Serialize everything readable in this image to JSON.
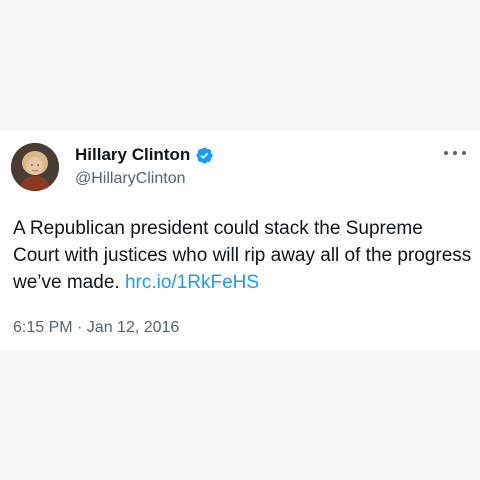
{
  "tweet": {
    "author": {
      "display_name": "Hillary Clinton",
      "handle": "@HillaryClinton",
      "verified": true,
      "avatar_icon": "profile-photo"
    },
    "text": "A Republican president could stack the Supreme Court with justices who will rip away all of the progress we’ve made.",
    "link": "hrc.io/1RkFeHS",
    "timestamp": "6:15 PM · Jan 12, 2016",
    "menu_icon": "more-options-icon"
  },
  "colors": {
    "page_background": "#f7f7f7",
    "card_background": "#ffffff",
    "text_primary": "#0f1419",
    "text_secondary": "#536471",
    "link": "#1d9bf0",
    "verified_badge": "#1d9bf0"
  }
}
